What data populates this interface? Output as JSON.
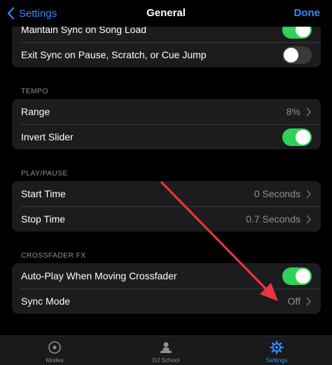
{
  "nav": {
    "back_label": "Settings",
    "title": "General",
    "done_label": "Done"
  },
  "sync_group": {
    "rows": [
      {
        "label": "Maintain Sync on Song Load",
        "toggle": "on"
      },
      {
        "label": "Exit Sync on Pause, Scratch, or Cue Jump",
        "toggle": "off"
      }
    ]
  },
  "tempo": {
    "header": "TEMPO",
    "range": {
      "label": "Range",
      "value": "8%"
    },
    "invert_slider": {
      "label": "Invert Slider",
      "toggle": "on"
    }
  },
  "play_pause": {
    "header": "PLAY/PAUSE",
    "start_time": {
      "label": "Start Time",
      "value": "0 Seconds"
    },
    "stop_time": {
      "label": "Stop Time",
      "value": "0.7 Seconds"
    }
  },
  "crossfader_fx": {
    "header": "CROSSFADER FX",
    "auto_play": {
      "label": "Auto-Play When Moving Crossfader",
      "toggle": "on"
    },
    "sync_mode": {
      "label": "Sync Mode",
      "value": "Off"
    }
  },
  "tabbar": {
    "tabs": [
      {
        "label": "Modes",
        "icon": "disc-icon",
        "active": false
      },
      {
        "label": "DJ School",
        "icon": "dj-icon",
        "active": false
      },
      {
        "label": "Settings",
        "icon": "gear-icon",
        "active": true
      }
    ]
  },
  "colors": {
    "accent": "#2f8bff",
    "toggle_on": "#30d158",
    "annotation_arrow": "#e8353f"
  }
}
